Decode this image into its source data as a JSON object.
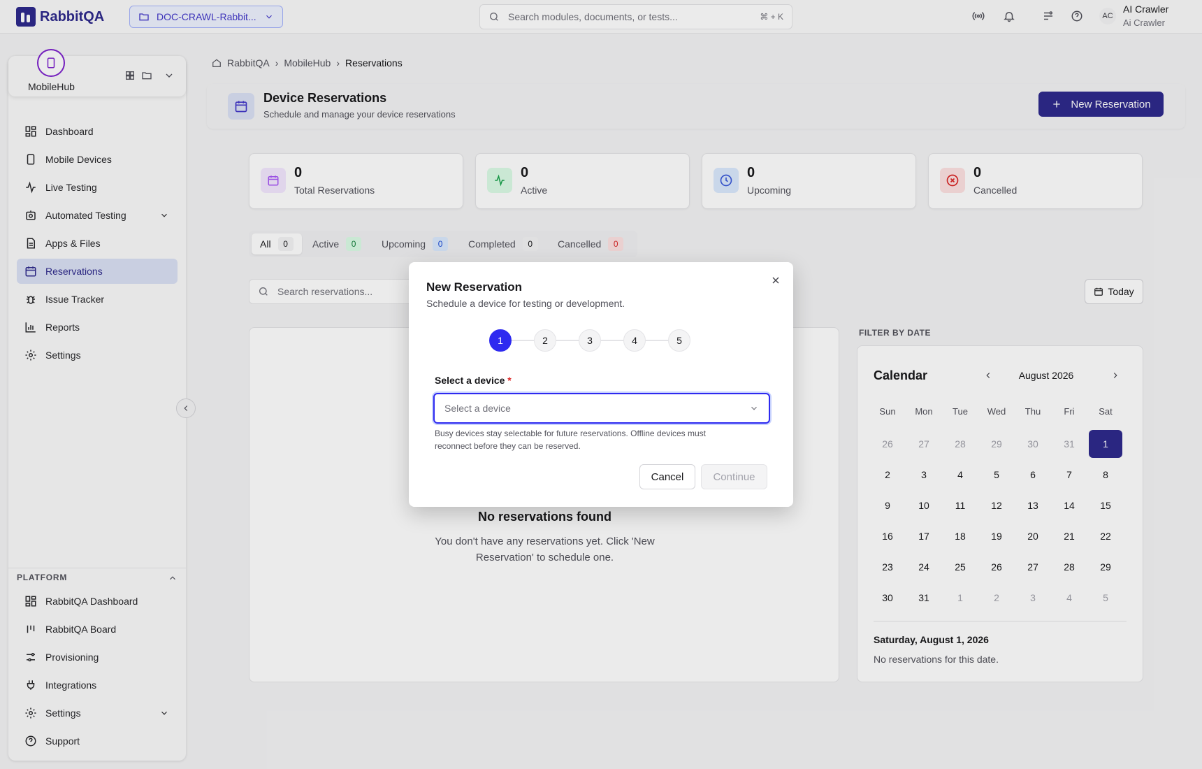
{
  "app": {
    "name": "RabbitQA",
    "brand_color": "#2e2a8c"
  },
  "topbar": {
    "project": "DOC-CRAWL-Rabbit...",
    "search_placeholder": "Search modules, documents, or tests...",
    "search_shortcut": "⌘ + K",
    "user": {
      "initials": "AC",
      "name": "AI Crawler",
      "sub": "Ai Crawler"
    }
  },
  "sidebar": {
    "workspace": "MobileHub",
    "items": [
      {
        "label": "Dashboard",
        "icon": "grid-icon"
      },
      {
        "label": "Mobile Devices",
        "icon": "phone-icon"
      },
      {
        "label": "Live Testing",
        "icon": "activity-icon"
      },
      {
        "label": "Automated Testing",
        "icon": "bot-icon"
      },
      {
        "label": "Apps & Files",
        "icon": "file-icon"
      },
      {
        "label": "Reservations",
        "icon": "calendar-icon",
        "active": true
      },
      {
        "label": "Issue Tracker",
        "icon": "bug-icon"
      },
      {
        "label": "Reports",
        "icon": "bar-chart-icon"
      },
      {
        "label": "Settings",
        "icon": "gear-icon"
      }
    ],
    "platform_title": "PLATFORM",
    "platform_items": [
      {
        "label": "RabbitQA Dashboard"
      },
      {
        "label": "RabbitQA Board"
      },
      {
        "label": "Provisioning"
      },
      {
        "label": "Integrations"
      },
      {
        "label": "Settings"
      },
      {
        "label": "Support"
      }
    ]
  },
  "breadcrumb": [
    "RabbitQA",
    "MobileHub",
    "Reservations"
  ],
  "header": {
    "title": "Device Reservations",
    "subtitle": "Schedule and manage your device reservations",
    "new_button": "New Reservation"
  },
  "stats": [
    {
      "value": "0",
      "label": "Total Reservations",
      "color": "#a855f7"
    },
    {
      "value": "0",
      "label": "Active",
      "color": "#16a34a"
    },
    {
      "value": "0",
      "label": "Upcoming",
      "color": "#3b5bdb"
    },
    {
      "value": "0",
      "label": "Cancelled",
      "color": "#dc2626"
    }
  ],
  "tabs": [
    {
      "label": "All",
      "count": "0"
    },
    {
      "label": "Active",
      "count": "0"
    },
    {
      "label": "Upcoming",
      "count": "0"
    },
    {
      "label": "Completed",
      "count": "0"
    },
    {
      "label": "Cancelled",
      "count": "0"
    }
  ],
  "list": {
    "search_placeholder": "Search reservations...",
    "today": "Today",
    "empty_title": "No reservations found",
    "empty_text": "You don't have any reservations yet. Click 'New Reservation' to schedule one."
  },
  "calendar": {
    "section_label": "FILTER BY DATE",
    "title": "Calendar",
    "month": "August 2026",
    "weekdays": [
      "Sun",
      "Mon",
      "Tue",
      "Wed",
      "Thu",
      "Fri",
      "Sat"
    ],
    "days": [
      "26",
      "27",
      "28",
      "29",
      "30",
      "31",
      "1",
      "2",
      "3",
      "4",
      "5",
      "6",
      "7",
      "8",
      "9",
      "10",
      "11",
      "12",
      "13",
      "14",
      "15",
      "16",
      "17",
      "18",
      "19",
      "20",
      "21",
      "22",
      "23",
      "24",
      "25",
      "26",
      "27",
      "28",
      "29",
      "30",
      "31",
      "1",
      "2",
      "3",
      "4",
      "5"
    ],
    "selected_date": "Saturday, August 1, 2026",
    "none_text": "No reservations for this date."
  },
  "modal": {
    "title": "New Reservation",
    "subtitle": "Schedule a device for testing or development.",
    "steps": [
      "1",
      "2",
      "3",
      "4",
      "5"
    ],
    "current_step": 1,
    "field_label": "Select a device",
    "required_mark": "*",
    "select_placeholder": "Select a device",
    "help": "Busy devices stay selectable for future reservations. Offline devices must reconnect before they can be reserved.",
    "cancel": "Cancel",
    "continue": "Continue"
  }
}
